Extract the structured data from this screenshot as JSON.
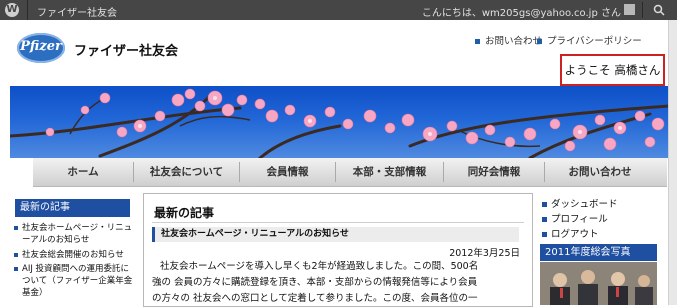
{
  "admin_bar": {
    "wp_icon": "wordpress-icon",
    "site_name": "ファイザー社友会",
    "howdy": "こんにちは、wm205gs@yahoo.co.jp さん",
    "search_icon": "search-icon"
  },
  "header": {
    "logo_text": "Pfizer",
    "site_title": "ファイザー社友会",
    "top_links": [
      "お問い合わせ",
      "プライバシーポリシー"
    ],
    "welcome": "ようこそ 高橋さん"
  },
  "nav": {
    "items": [
      "ホーム",
      "社友会について",
      "会員情報",
      "本部・支部情報",
      "同好会情報",
      "お問い合わせ"
    ]
  },
  "left_sidebar": {
    "heading": "最新の記事",
    "items": [
      "社友会ホームページ・リニューアルのお知らせ",
      "社友会総会開催のお知らせ",
      "AIJ 投資顧問への運用委託について（ファイザー企業年金基金）"
    ]
  },
  "main": {
    "heading": "最新の記事",
    "post_title": "社友会ホームページ・リニューアルのお知らせ",
    "post_date": "2012年3月25日",
    "body_lines": [
      "社友会ホームページを導入し早くも2年が経過致しました。この間、500名",
      "強の 会員の方々に購読登録を頂き、本部・支部からの情報発信等により会員",
      "の方々の 社友会への窓口として定着して参りました。この度、会員各位の一"
    ]
  },
  "right_sidebar": {
    "items": [
      "ダッシュボード",
      "プロフィール",
      "ログアウト"
    ],
    "photo_heading": "2011年度総会写真"
  },
  "colors": {
    "admin_bar": "#464646",
    "accent_blue": "#1f4fa0",
    "highlight_border": "#cc2222"
  }
}
